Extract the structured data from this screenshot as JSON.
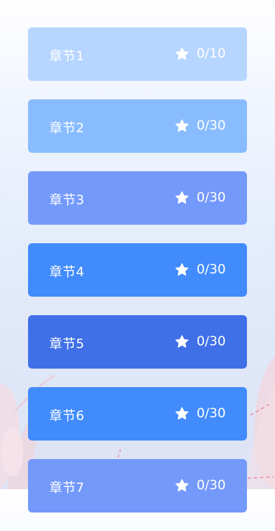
{
  "chapters": [
    {
      "title": "章节1",
      "score": "0/10",
      "color": "#b6d5ff"
    },
    {
      "title": "章节2",
      "score": "0/30",
      "color": "#89bcff"
    },
    {
      "title": "章节3",
      "score": "0/30",
      "color": "#7399fb"
    },
    {
      "title": "章节4",
      "score": "0/30",
      "color": "#418bfc"
    },
    {
      "title": "章节5",
      "score": "0/30",
      "color": "#4070e8"
    },
    {
      "title": "章节6",
      "score": "0/30",
      "color": "#418bfc"
    },
    {
      "title": "章节7",
      "score": "0/30",
      "color": "#7399fb"
    }
  ],
  "icons": {
    "star": "star-icon"
  }
}
